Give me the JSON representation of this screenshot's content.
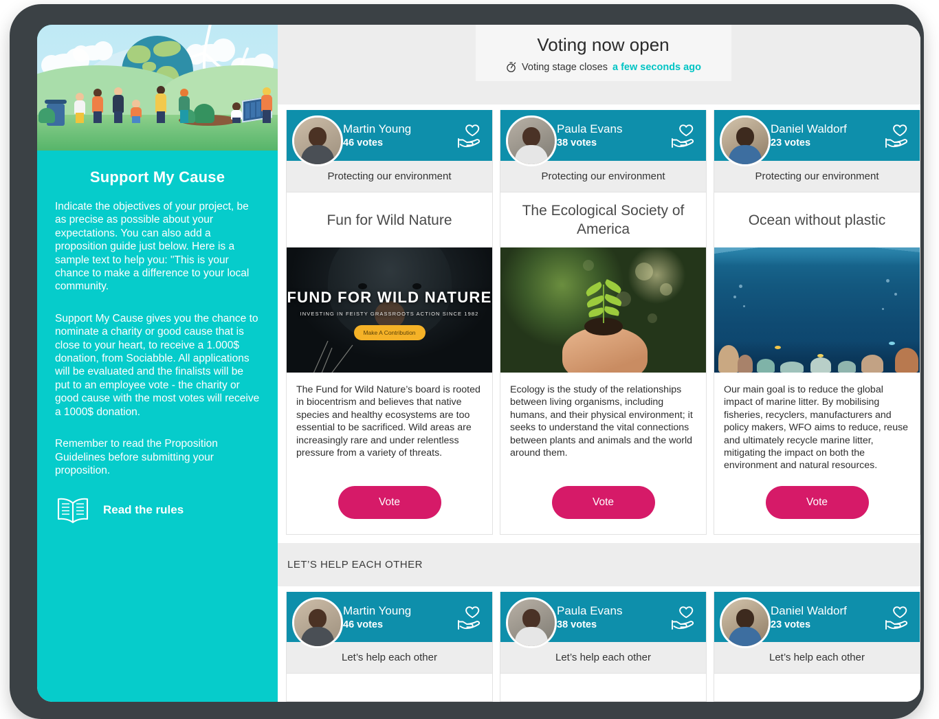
{
  "sidebar": {
    "hero_alt": "environment-illustration",
    "title": "Support My Cause",
    "paragraphs": [
      "Indicate the objectives of your project, be as precise as possible about your expectations. You can also add a proposition guide just below. Here is a sample text to help you: \"This is your chance to make a difference to your local community.",
      "Support My Cause gives you the chance to nominate a charity or good cause that is close to your heart, to receive a 1.000$ donation, from Sociabble. All applications will be evaluated and the finalists will be put to an employee vote - the charity or good cause with the most votes will receive a 1000$ donation.",
      "Remember to read the Proposition Guidelines before submitting your proposition."
    ],
    "read_rules_label": "Read the rules",
    "bg_color": "#06cccb"
  },
  "topbar": {
    "title": "Voting now open",
    "subtitle_prefix": "Voting stage closes",
    "subtitle_accent": "a few seconds ago",
    "accent_color": "#00c4c4"
  },
  "voting_cards": [
    {
      "name": "Martin Young",
      "votes": "46 votes",
      "category": "Protecting our environment",
      "title": "Fun for Wild Nature",
      "image_kind": "bear",
      "image_title": "FUND FOR WILD NATURE",
      "image_subtitle": "INVESTING IN FEISTY GRASSROOTS ACTION SINCE 1982",
      "image_button": "Make A Contribution",
      "description": "The Fund for Wild Nature’s board is rooted in biocentrism and believes that native species and healthy ecosystems are too essential to be sacrificed. Wild areas are increasingly rare and under relentless pressure from a variety of threats.",
      "vote_label": "Vote"
    },
    {
      "name": "Paula Evans",
      "votes": "38 votes",
      "category": "Protecting our environment",
      "title": "The Ecological Society of America",
      "image_kind": "seedling",
      "description": "Ecology is the study of the relationships between living organisms, including humans, and their physical environment; it seeks to understand the vital connections between plants and animals and the world around them.",
      "vote_label": "Vote"
    },
    {
      "name": "Daniel Waldorf",
      "votes": "23 votes",
      "category": "Protecting our environment",
      "title": "Ocean without plastic",
      "image_kind": "ocean",
      "description": "Our main goal is to reduce the global impact of marine litter. By mobilising fisheries, recyclers, manufacturers and policy makers, WFO aims to reduce, reuse and ultimately recycle marine litter, mitigating the impact on both the environment and natural resources.",
      "vote_label": "Vote"
    }
  ],
  "section": {
    "label": "LET’S HELP EACH OTHER"
  },
  "help_cards": [
    {
      "name": "Martin Young",
      "votes": "46 votes",
      "category": "Let’s help each other"
    },
    {
      "name": "Paula Evans",
      "votes": "38 votes",
      "category": "Let’s help each other"
    },
    {
      "name": "Daniel Waldorf",
      "votes": "23 votes",
      "category": "Let’s help each other"
    }
  ],
  "colors": {
    "card_header": "#0e8fab",
    "vote_button": "#d61a68",
    "frame": "#3b4145"
  }
}
